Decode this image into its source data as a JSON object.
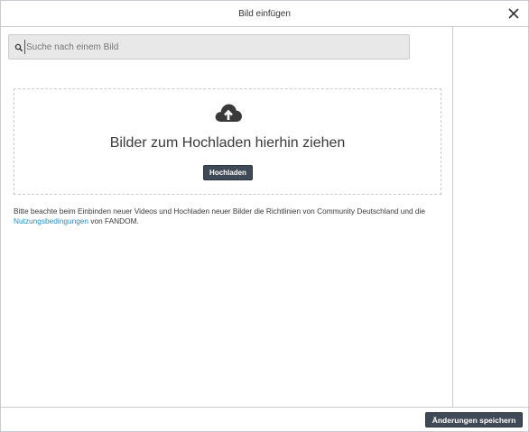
{
  "dialog": {
    "title": "Bild einfügen"
  },
  "search": {
    "placeholder": "Suche nach einem Bild",
    "value": ""
  },
  "dropzone": {
    "text": "Bilder zum Hochladen hierhin ziehen",
    "upload_label": "Hochladen",
    "icon": "cloud-upload-icon"
  },
  "notice": {
    "text_before": "Bitte beachte beim Einbinden neuer Videos und Hochladen neuer Bilder die Richtlinien von Community Deutschland und die ",
    "link_label": "Nutzungsbedingungen",
    "text_after": " von FANDOM."
  },
  "footer": {
    "save_label": "Änderungen speichern"
  },
  "colors": {
    "button_bg": "#404a57",
    "link": "#2a8bbf",
    "border": "#c8ccd1",
    "search_bg": "#e8e8e8"
  }
}
